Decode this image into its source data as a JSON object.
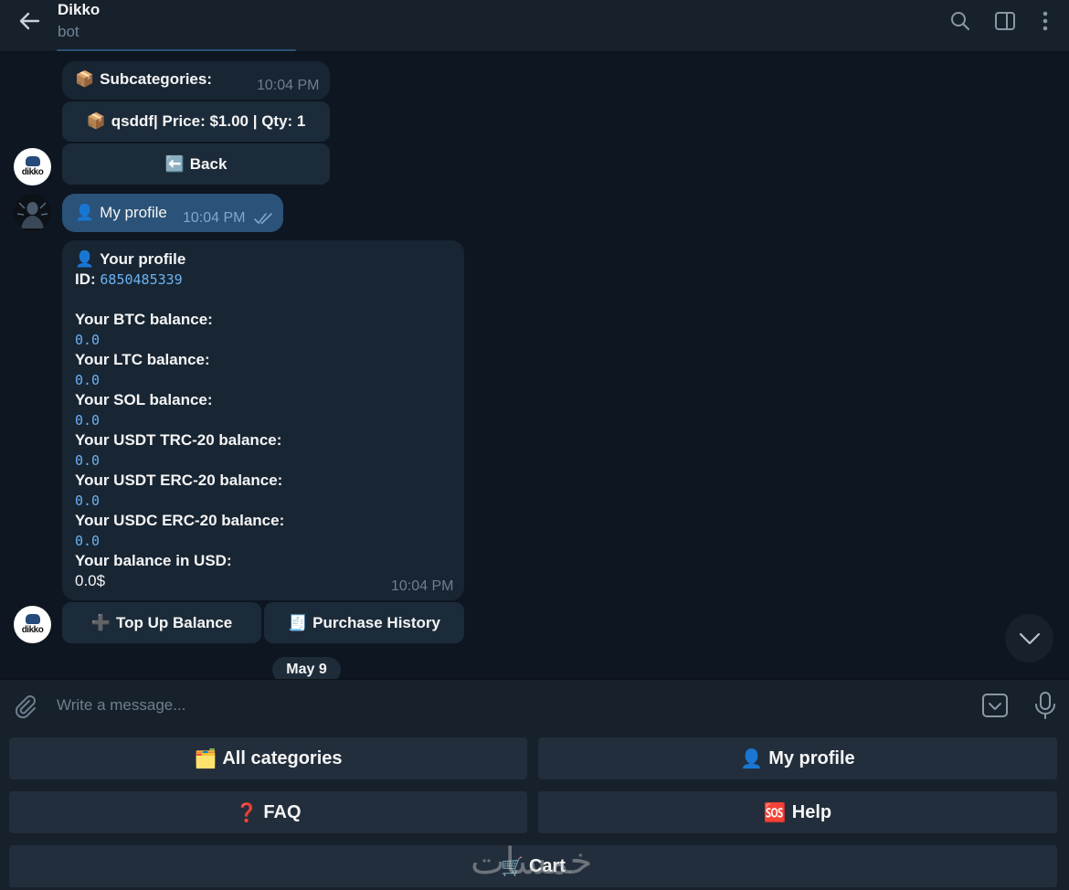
{
  "header": {
    "title": "Dikko",
    "subtitle": "bot"
  },
  "messages": {
    "subcategories": {
      "emoji": "📦",
      "text": "Subcategories:",
      "time": "10:04 PM"
    },
    "product_button": {
      "emoji": "📦",
      "label": "qsddf| Price: $1.00 | Qty: 1"
    },
    "back_button": {
      "emoji": "⬅️",
      "label": "Back"
    },
    "user_message": {
      "emoji": "👤",
      "text": "My profile",
      "time": "10:04 PM"
    },
    "profile": {
      "heading_emoji": "👤",
      "heading": "Your profile",
      "id_label": "ID:",
      "id_value": "6850485339",
      "balances": [
        {
          "label": "Your BTC balance:",
          "value": "0.0"
        },
        {
          "label": "Your LTC balance:",
          "value": "0.0"
        },
        {
          "label": "Your SOL balance:",
          "value": "0.0"
        },
        {
          "label": "Your USDT TRC-20 balance:",
          "value": "0.0"
        },
        {
          "label": "Your USDT ERC-20 balance:",
          "value": "0.0"
        },
        {
          "label": "Your USDC ERC-20 balance:",
          "value": "0.0"
        }
      ],
      "usd_label": "Your balance in USD:",
      "usd_value": "0.0$",
      "time": "10:04 PM"
    },
    "topup_button": {
      "emoji": "➕",
      "label": "Top Up Balance"
    },
    "history_button": {
      "emoji": "🧾",
      "label": "Purchase History"
    },
    "date_separator": "May 9"
  },
  "avatar": {
    "label": "dikko"
  },
  "composer": {
    "placeholder": "Write a message..."
  },
  "keyboard": [
    {
      "emoji": "🗂️",
      "label": "All categories"
    },
    {
      "emoji": "👤",
      "label": "My profile"
    },
    {
      "emoji": "❓",
      "label": "FAQ"
    },
    {
      "emoji": "🆘",
      "label": "Help"
    },
    {
      "emoji": "🛒",
      "label": "Cart"
    }
  ],
  "watermark": "خمسات",
  "colors": {
    "background": "#0e1621",
    "header": "#17212b",
    "incoming_bubble": "#182533",
    "outgoing_bubble": "#2b5278",
    "link_mono": "#6ab3f3",
    "keyboard_button": "#232e3c"
  }
}
